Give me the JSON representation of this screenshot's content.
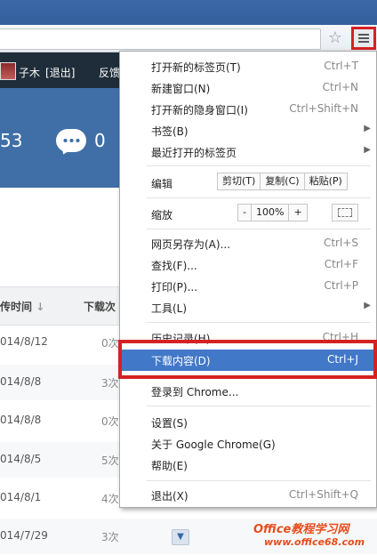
{
  "browser": {
    "star_icon": "star-icon",
    "menu_icon": "hamburger-menu-icon"
  },
  "site": {
    "user_name": "子木",
    "logout": "[退出]",
    "feedback": "反馈",
    "stat_one": "53",
    "stat_two": "0",
    "columns": [
      "传时间",
      "下载次"
    ],
    "sort_glyph": "↓",
    "rows": [
      {
        "date": "014/8/12",
        "count": "0次"
      },
      {
        "date": "014/8/8",
        "count": "3次"
      },
      {
        "date": "014/8/8",
        "count": "0次"
      },
      {
        "date": "014/8/5",
        "count": "5次"
      },
      {
        "date": "014/8/1",
        "count": "4次"
      },
      {
        "date": "014/7/29",
        "count": "3次"
      }
    ]
  },
  "menu": {
    "items": [
      {
        "label": "打开新的标签页(T)",
        "shortcut": "Ctrl+T"
      },
      {
        "label": "新建窗口(N)",
        "shortcut": "Ctrl+N"
      },
      {
        "label": "打开新的隐身窗口(I)",
        "shortcut": "Ctrl+Shift+N"
      },
      {
        "label": "书签(B)",
        "arrow": "▶"
      },
      {
        "label": "最近打开的标签页",
        "arrow": "▶"
      },
      {
        "label": "编辑"
      },
      {
        "label": "缩放"
      },
      {
        "label": "网页另存为(A)...",
        "shortcut": "Ctrl+S"
      },
      {
        "label": "查找(F)...",
        "shortcut": "Ctrl+F"
      },
      {
        "label": "打印(P)...",
        "shortcut": "Ctrl+P"
      },
      {
        "label": "工具(L)",
        "arrow": "▶"
      },
      {
        "label": "历史记录(H)",
        "shortcut": "Ctrl+H"
      },
      {
        "label": "下载内容(D)",
        "shortcut": "Ctrl+J"
      },
      {
        "label": "登录到 Chrome..."
      },
      {
        "label": "设置(S)"
      },
      {
        "label": "关于 Google Chrome(G)"
      },
      {
        "label": "帮助(E)"
      },
      {
        "label": "退出(X)",
        "shortcut": "Ctrl+Shift+Q"
      }
    ],
    "edit_buttons": [
      "剪切(T)",
      "复制(C)",
      "粘贴(P)"
    ],
    "zoom": {
      "minus": "-",
      "value": "100%",
      "plus": "+"
    },
    "highlighted_index": 12
  },
  "watermark": {
    "brand": "Office教程学习网",
    "url": "www.office68.com"
  },
  "colors": {
    "banner": "#3f6fa6",
    "highlight": "#4178c8",
    "callout": "#d42222"
  }
}
